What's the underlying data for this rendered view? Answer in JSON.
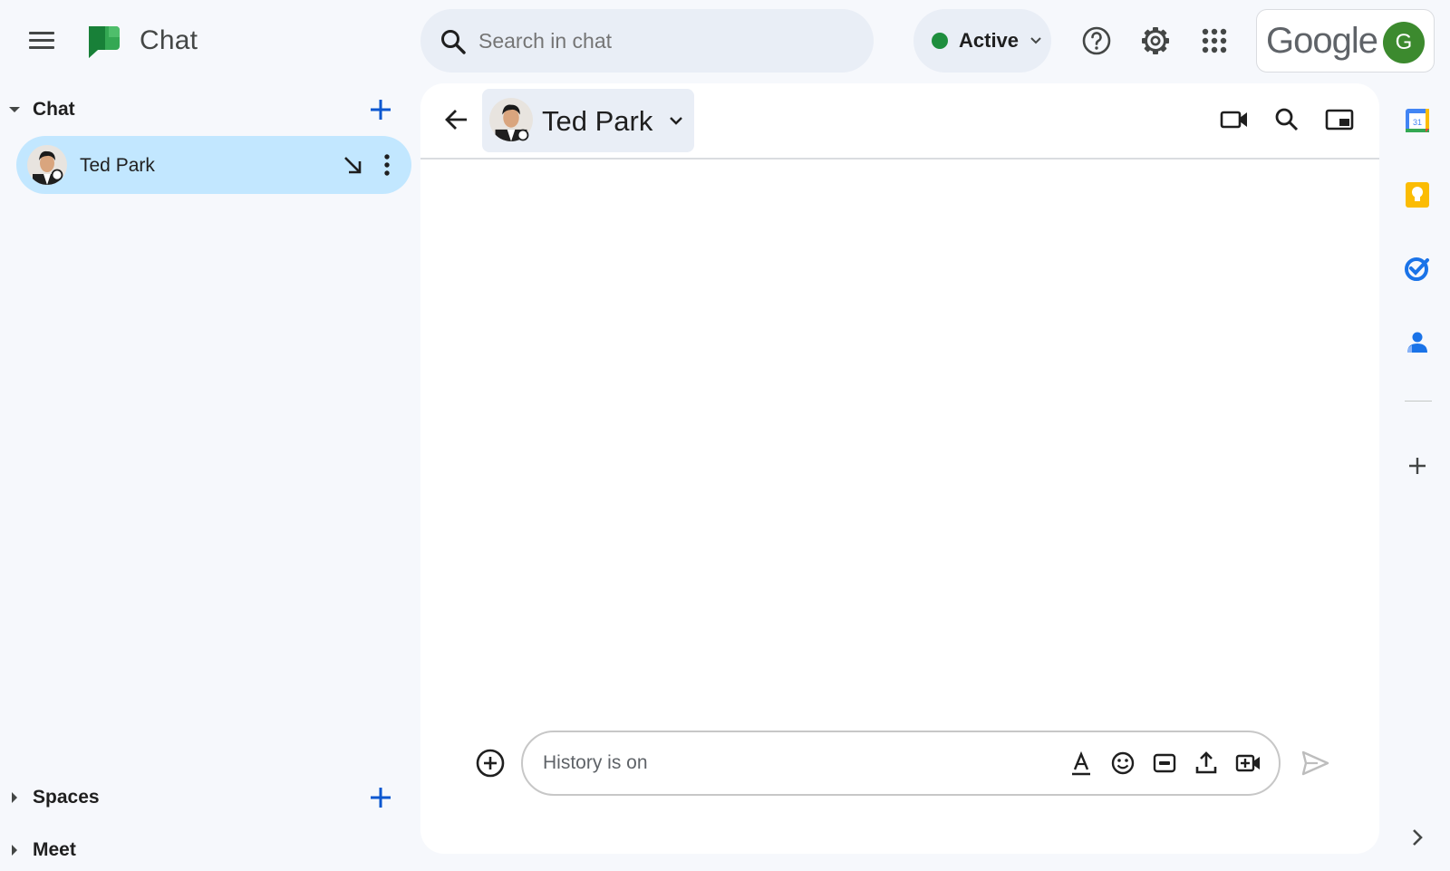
{
  "app": {
    "title": "Chat"
  },
  "search": {
    "placeholder": "Search in chat"
  },
  "status": {
    "label": "Active",
    "color": "#1e8e3e"
  },
  "account": {
    "brand": "Google",
    "initial": "G",
    "avatar_color": "#3c8a2e"
  },
  "sidebar": {
    "sections": [
      {
        "title": "Chat",
        "expanded": true
      },
      {
        "title": "Spaces",
        "expanded": false
      },
      {
        "title": "Meet",
        "expanded": false
      }
    ],
    "dms": [
      {
        "name": "Ted Park",
        "selected": true,
        "presence": "offline"
      }
    ]
  },
  "conversation": {
    "name": "Ted Park",
    "composer_placeholder": "History is on"
  },
  "icons": {
    "top": [
      "menu-icon",
      "help-icon",
      "settings-icon",
      "apps-grid-icon"
    ],
    "header": [
      "back-arrow-icon",
      "video-call-icon",
      "search-icon",
      "picture-in-picture-icon"
    ],
    "composer": [
      "add-circle-icon",
      "text-format-icon",
      "emoji-icon",
      "gif-icon",
      "upload-icon",
      "meet-add-icon",
      "send-icon"
    ],
    "rail": [
      "calendar-icon",
      "keep-icon",
      "tasks-icon",
      "contacts-icon",
      "add-icon",
      "chevron-right-icon"
    ]
  },
  "colors": {
    "accent": "#0b57d0",
    "selected_bg": "#c2e7ff",
    "page_bg": "#f6f8fc"
  }
}
